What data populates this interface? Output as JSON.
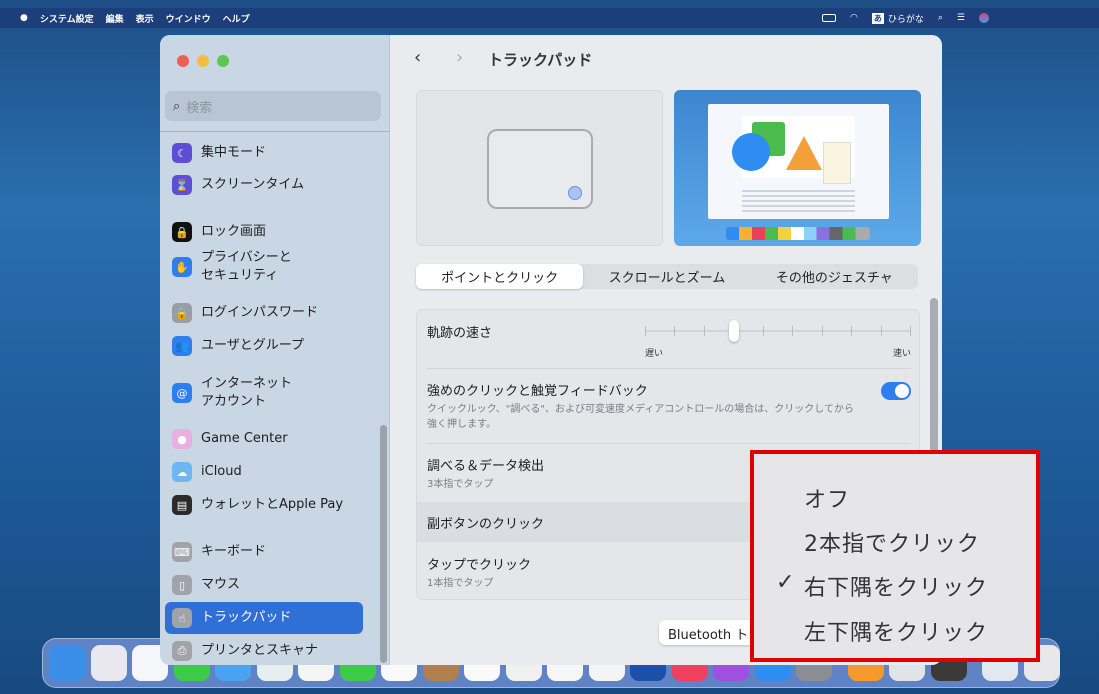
{
  "menubar": {
    "apple": "",
    "app": "システム設定",
    "items": [
      "編集",
      "表示",
      "ウインドウ",
      "ヘルプ"
    ],
    "input_mode": "ひらがな",
    "input_badge": "あ"
  },
  "sidebar": {
    "search_placeholder": "検索",
    "items": [
      {
        "label": "集中モード",
        "color": "#5b4fd6",
        "icon": "moon-icon",
        "glyph": "☾"
      },
      {
        "label": "スクリーンタイム",
        "color": "#5b4fd6",
        "icon": "hourglass-icon",
        "glyph": "⌛"
      },
      {
        "label": "ロック画面",
        "color": "#111111",
        "icon": "lock-screen-icon",
        "glyph": "🔒"
      },
      {
        "label": "プライバシーと\nセキュリティ",
        "color": "#2f7ef0",
        "icon": "hand-icon",
        "glyph": "✋"
      },
      {
        "label": "ログインパスワード",
        "color": "#9a9ea4",
        "icon": "key-lock-icon",
        "glyph": "🔒"
      },
      {
        "label": "ユーザとグループ",
        "color": "#2f7ef0",
        "icon": "users-icon",
        "glyph": "👥"
      },
      {
        "label": "インターネット\nアカウント",
        "color": "#2f7ef0",
        "icon": "at-icon",
        "glyph": "@"
      },
      {
        "label": "Game Center",
        "color": "#e8b0e0",
        "icon": "game-center-icon",
        "glyph": "●"
      },
      {
        "label": "iCloud",
        "color": "#6fb6f0",
        "icon": "icloud-icon",
        "glyph": "☁"
      },
      {
        "label": "ウォレットとApple Pay",
        "color": "#2b2b2b",
        "icon": "wallet-icon",
        "glyph": "▤"
      },
      {
        "label": "キーボード",
        "color": "#a0a4aa",
        "icon": "keyboard-icon",
        "glyph": "⌨"
      },
      {
        "label": "マウス",
        "color": "#a0a4aa",
        "icon": "mouse-icon",
        "glyph": "▯"
      },
      {
        "label": "トラックパッド",
        "color": "#a0a4aa",
        "icon": "trackpad-icon",
        "glyph": "☝",
        "selected": true
      },
      {
        "label": "プリンタとスキャナ",
        "color": "#a0a4aa",
        "icon": "printer-icon",
        "glyph": "⎙"
      }
    ]
  },
  "main": {
    "title": "トラックパッド",
    "tabs": [
      {
        "label": "ポイントとクリック",
        "active": true
      },
      {
        "label": "スクロールとズーム"
      },
      {
        "label": "その他のジェスチャ"
      }
    ],
    "tracking": {
      "label": "軌跡の速さ",
      "slow": "遅い",
      "fast": "速い",
      "value_fraction": 0.333,
      "ticks": 10
    },
    "force_click": {
      "label": "強めのクリックと触覚フィードバック",
      "desc": "クイックルック、\"調べる\"、および可変速度メディアコントロールの場合は、クリックしてから強く押します。",
      "on": true
    },
    "lookup": {
      "label": "調べる＆データ検出",
      "value": "3本指でタップ"
    },
    "secondary": {
      "label": "副ボタンのクリック"
    },
    "tap": {
      "label": "タップでクリック",
      "value": "1本指でタップ"
    },
    "bluetooth_button": "Bluetooth ト"
  },
  "popup": {
    "items": [
      {
        "label": "オフ"
      },
      {
        "label": "2本指でクリック"
      },
      {
        "label": "右下隅をクリック",
        "checked": true
      },
      {
        "label": "左下隅をクリック"
      }
    ],
    "check": "✓"
  },
  "colors": {
    "accent": "#2f6fd6",
    "toggle": "#2f7ef0",
    "highlight_border": "#e00000"
  },
  "dock": {
    "icons": [
      {
        "name": "finder-icon",
        "color": "#3a8ee8"
      },
      {
        "name": "launchpad-icon",
        "color": "#e8e8ee"
      },
      {
        "name": "safari-icon",
        "color": "#f4f6fa"
      },
      {
        "name": "messages-icon",
        "color": "#3ecb4a"
      },
      {
        "name": "mail-icon",
        "color": "#4aa3f0"
      },
      {
        "name": "maps-icon",
        "color": "#e6eef0"
      },
      {
        "name": "photos-icon",
        "color": "#f5f5f5"
      },
      {
        "name": "facetime-icon",
        "color": "#3ecb4a"
      },
      {
        "name": "clock-icon",
        "color": "#fafafa"
      },
      {
        "name": "contacts-icon",
        "color": "#b08050"
      },
      {
        "name": "calendar-icon",
        "color": "#fafafa"
      },
      {
        "name": "reminders-icon",
        "color": "#f0f0f0"
      },
      {
        "name": "notes-icon",
        "color": "#f6f6f6"
      },
      {
        "name": "chrome-icon",
        "color": "#f4f4f4"
      },
      {
        "name": "word-icon",
        "color": "#1d4fa8"
      },
      {
        "name": "music-icon",
        "color": "#f04060"
      },
      {
        "name": "podcasts-icon",
        "color": "#a050e0"
      },
      {
        "name": "app-store-icon",
        "color": "#2f8cf0"
      },
      {
        "name": "system-settings-icon",
        "color": "#8a8e94"
      },
      {
        "name": "pages-icon",
        "color": "#f59a2a"
      },
      {
        "name": "preview-icon",
        "color": "#e0e4e8"
      },
      {
        "name": "keychain-icon",
        "color": "#3a3a3a"
      },
      {
        "name": "downloads-icon",
        "color": "#e0e8f0"
      },
      {
        "name": "trash-icon",
        "color": "#e8e8ea"
      }
    ]
  }
}
